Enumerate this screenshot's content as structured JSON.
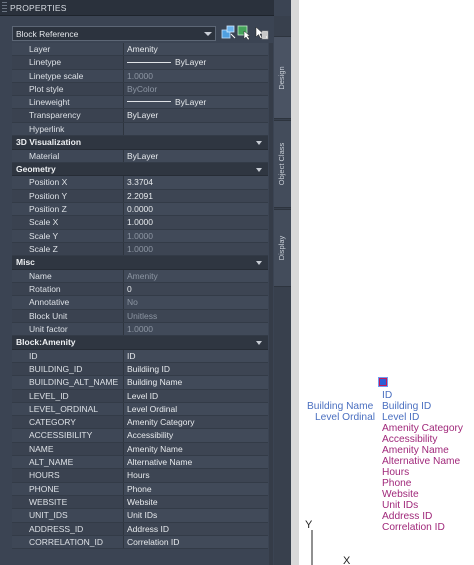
{
  "panel": {
    "title": "PROPERTIES",
    "object_type": "Block Reference",
    "tabs": [
      "Design",
      "Object Class",
      "Display"
    ]
  },
  "general_rows": [
    {
      "label": "Layer",
      "value": "Amenity",
      "readonly": false
    },
    {
      "label": "Linetype",
      "value": "ByLayer",
      "readonly": false,
      "swatch": true
    },
    {
      "label": "Linetype scale",
      "value": "1.0000",
      "readonly": true
    },
    {
      "label": "Plot style",
      "value": "ByColor",
      "readonly": true
    },
    {
      "label": "Lineweight",
      "value": "ByLayer",
      "readonly": false,
      "swatch": true
    },
    {
      "label": "Transparency",
      "value": "ByLayer",
      "readonly": false
    },
    {
      "label": "Hyperlink",
      "value": "",
      "readonly": false
    }
  ],
  "sections": [
    {
      "title": "3D Visualization",
      "rows": [
        {
          "label": "Material",
          "value": "ByLayer",
          "readonly": false
        }
      ]
    },
    {
      "title": "Geometry",
      "rows": [
        {
          "label": "Position X",
          "value": "3.3704",
          "readonly": false
        },
        {
          "label": "Position Y",
          "value": "2.2091",
          "readonly": false
        },
        {
          "label": "Position Z",
          "value": "0.0000",
          "readonly": false
        },
        {
          "label": "Scale X",
          "value": "1.0000",
          "readonly": false
        },
        {
          "label": "Scale Y",
          "value": "1.0000",
          "readonly": true
        },
        {
          "label": "Scale Z",
          "value": "1.0000",
          "readonly": true
        }
      ]
    },
    {
      "title": "Misc",
      "rows": [
        {
          "label": "Name",
          "value": "Amenity",
          "readonly": true
        },
        {
          "label": "Rotation",
          "value": "0",
          "readonly": false
        },
        {
          "label": "Annotative",
          "value": "No",
          "readonly": true
        },
        {
          "label": "Block Unit",
          "value": "Unitless",
          "readonly": true
        },
        {
          "label": "Unit factor",
          "value": "1.0000",
          "readonly": true
        }
      ]
    },
    {
      "title": "Block:Amenity",
      "rows": [
        {
          "label": "ID",
          "value": "ID",
          "readonly": false
        },
        {
          "label": "BUILDING_ID",
          "value": "Buildiing ID",
          "readonly": false
        },
        {
          "label": "BUILDING_ALT_NAME",
          "value": "Building Name",
          "readonly": false
        },
        {
          "label": "LEVEL_ID",
          "value": "Level ID",
          "readonly": false
        },
        {
          "label": "LEVEL_ORDINAL",
          "value": "Level Ordinal",
          "readonly": false
        },
        {
          "label": "CATEGORY",
          "value": "Amenity Category",
          "readonly": false
        },
        {
          "label": "ACCESSIBILITY",
          "value": "Accessibility",
          "readonly": false
        },
        {
          "label": "NAME",
          "value": "Amenity Name",
          "readonly": false
        },
        {
          "label": "ALT_NAME",
          "value": "Alternative Name",
          "readonly": false
        },
        {
          "label": "HOURS",
          "value": "Hours",
          "readonly": false
        },
        {
          "label": "PHONE",
          "value": "Phone",
          "readonly": false
        },
        {
          "label": "WEBSITE",
          "value": "Website",
          "readonly": false
        },
        {
          "label": "UNIT_IDS",
          "value": "Unit IDs",
          "readonly": false
        },
        {
          "label": "ADDRESS_ID",
          "value": "Address ID",
          "readonly": false
        },
        {
          "label": "CORRELATION_ID",
          "value": "Correlation ID",
          "readonly": false
        }
      ]
    }
  ],
  "drawing": {
    "left_labels": [
      "Building Name",
      "Level Ordinal"
    ],
    "attribute_labels": [
      "ID",
      "Building ID",
      "Level ID",
      "Amenity Category",
      "Accessibility",
      "Amenity Name",
      "Alternative Name",
      "Hours",
      "Phone",
      "Website",
      "Unit IDs",
      "Address ID",
      "Correlation ID"
    ],
    "blue_count": 3,
    "ucs_y": "Y",
    "ucs_x": "X"
  },
  "colors": {
    "panel_bg": "#3b4453",
    "attr_blue": "#4a6fc0",
    "attr_magenta": "#a0287a",
    "grip_blue": "#2b5fd6"
  }
}
